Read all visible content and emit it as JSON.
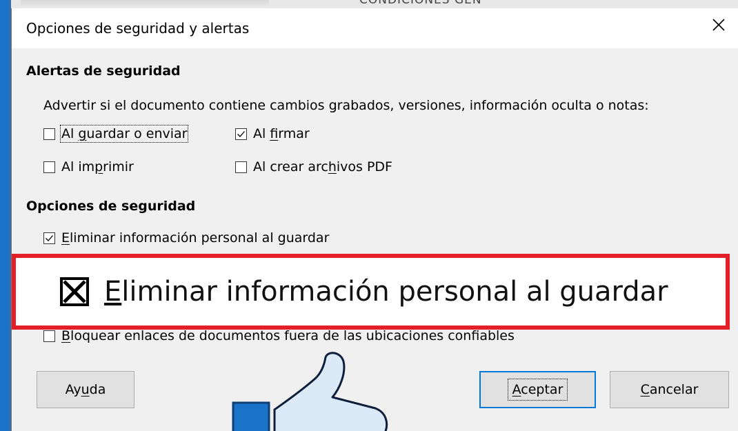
{
  "dialog": {
    "title": "Opciones de seguridad y alertas",
    "close_label": "close"
  },
  "background": {
    "top_text": "CONDICIONES GEN"
  },
  "alerts": {
    "heading": "Alertas de seguridad",
    "description": "Advertir si el documento contiene cambios grabados, versiones, información oculta o notas:",
    "options": [
      {
        "pre": "Al ",
        "u": "g",
        "post": "uardar o enviar",
        "checked": false
      },
      {
        "pre": "Al ",
        "u": "f",
        "post": "irmar",
        "checked": true
      },
      {
        "pre": "Al im",
        "u": "p",
        "post": "rimir",
        "checked": false
      },
      {
        "pre": "Al crear arc",
        "u": "h",
        "post": "ivos PDF",
        "checked": false
      }
    ]
  },
  "security": {
    "heading": "Opciones de seguridad",
    "options": [
      {
        "pre": "",
        "u": "E",
        "post": "liminar información personal al guardar",
        "checked": true
      },
      {
        "pre": "",
        "u": "B",
        "post": "loquear enlaces de documentos fuera de las ubicaciones confiables",
        "checked": false
      }
    ]
  },
  "zoom": {
    "u": "E",
    "post": "liminar información personal al guardar",
    "checked": true
  },
  "buttons": {
    "help": {
      "pre": "Ay",
      "u": "u",
      "post": "da"
    },
    "accept": {
      "pre": "",
      "u": "A",
      "post": "ceptar"
    },
    "cancel": {
      "pre": "",
      "u": "C",
      "post": "ancelar"
    }
  }
}
